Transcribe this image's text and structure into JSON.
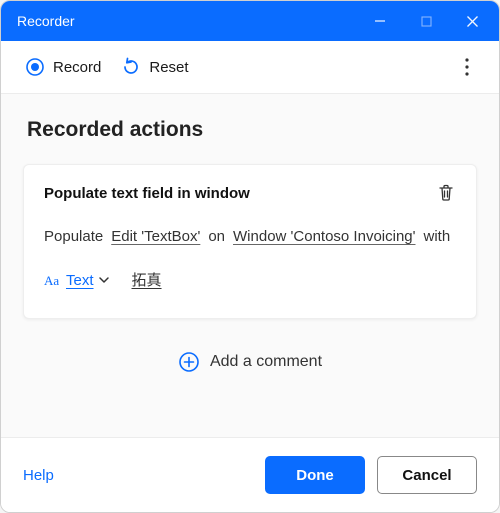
{
  "window": {
    "title": "Recorder"
  },
  "toolbar": {
    "record_label": "Record",
    "reset_label": "Reset"
  },
  "section": {
    "heading": "Recorded actions"
  },
  "action": {
    "title": "Populate text field in window",
    "word_populate": "Populate",
    "field_ref": "Edit 'TextBox'",
    "word_on": "on",
    "window_ref": "Window 'Contoso Invoicing'",
    "word_with": "with",
    "type_label": "Text",
    "value": "拓真"
  },
  "add_comment_label": "Add a comment",
  "footer": {
    "help": "Help",
    "done": "Done",
    "cancel": "Cancel"
  }
}
